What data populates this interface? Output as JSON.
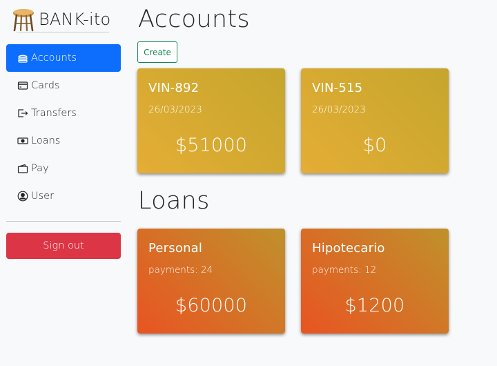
{
  "brand": {
    "name": "BANK-ito",
    "logo_icon": "stool-icon"
  },
  "sidebar": {
    "items": [
      {
        "label": "Accounts",
        "icon": "bank-icon",
        "active": true
      },
      {
        "label": "Cards",
        "icon": "credit-card-icon",
        "active": false
      },
      {
        "label": "Transfers",
        "icon": "transfer-icon",
        "active": false
      },
      {
        "label": "Loans",
        "icon": "cash-icon",
        "active": false
      },
      {
        "label": "Pay",
        "icon": "wallet-icon",
        "active": false
      },
      {
        "label": "User",
        "icon": "user-circle-icon",
        "active": false
      }
    ],
    "signout_label": "Sign out"
  },
  "accounts": {
    "title": "Accounts",
    "create_label": "Create",
    "cards": [
      {
        "number": "VIN-892",
        "date": "26/03/2023",
        "balance": "$51000"
      },
      {
        "number": "VIN-515",
        "date": "26/03/2023",
        "balance": "$0"
      }
    ]
  },
  "loans": {
    "title": "Loans",
    "cards": [
      {
        "name": "Personal",
        "payments": "payments: 24",
        "amount": "$60000"
      },
      {
        "name": "Hipotecario",
        "payments": "payments: 12",
        "amount": "$1200"
      }
    ]
  },
  "colors": {
    "primary": "#0d6efd",
    "danger": "#dc3545",
    "success": "#198754",
    "account_card": "#d9aa33",
    "loan_card": "#e06a25"
  }
}
